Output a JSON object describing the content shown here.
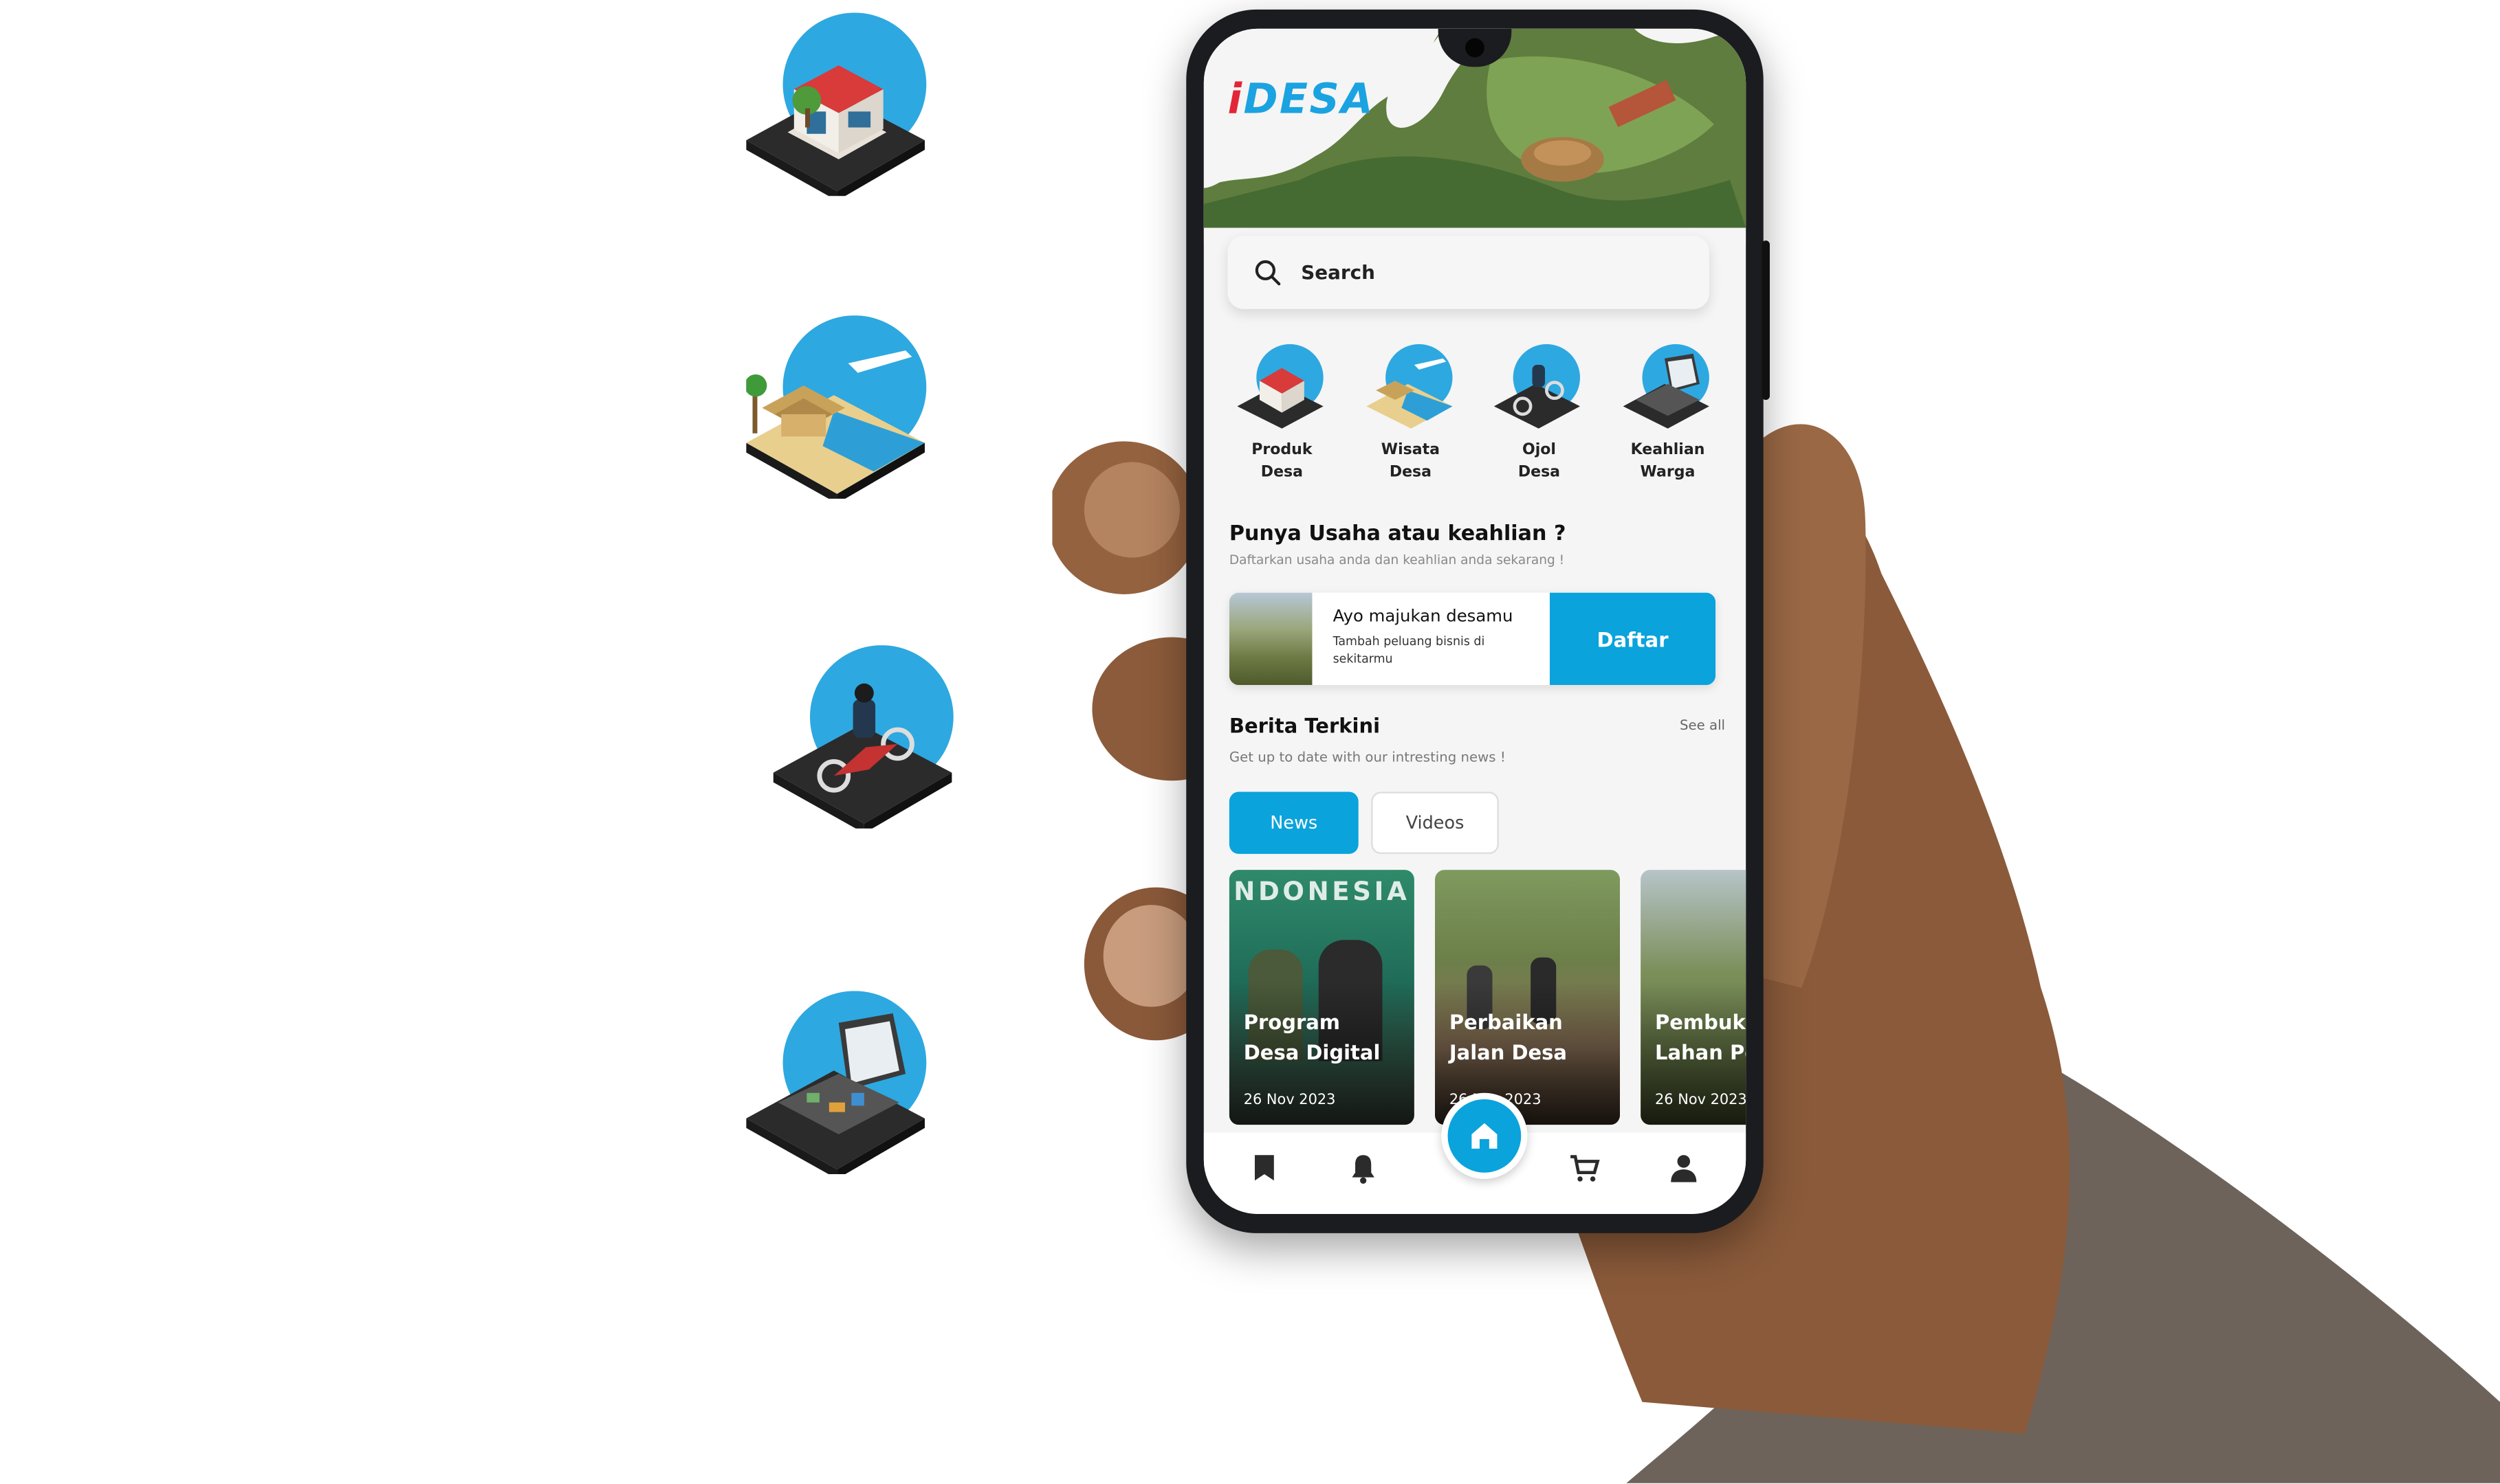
{
  "app": {
    "logo_text": "iDESA"
  },
  "search": {
    "placeholder": "Search"
  },
  "categories": [
    {
      "label_line1": "Produk",
      "label_line2": "Desa",
      "icon": "shop-icon"
    },
    {
      "label_line1": "Wisata",
      "label_line2": "Desa",
      "icon": "beach-resort-icon"
    },
    {
      "label_line1": "Ojol",
      "label_line2": "Desa",
      "icon": "motorbike-icon"
    },
    {
      "label_line1": "Keahlian",
      "label_line2": "Warga",
      "icon": "toolkit-laptop-icon"
    }
  ],
  "promo": {
    "title": "Punya Usaha atau keahlian ?",
    "subtitle": "Daftarkan usaha anda dan keahlian anda sekarang !",
    "card_title": "Ayo majukan desamu",
    "card_text": "Tambah peluang bisnis di sekitarmu",
    "button": "Daftar"
  },
  "news": {
    "title": "Berita Terkini",
    "see_all": "See all",
    "subtitle": "Get up to date with our intresting news !",
    "tabs": [
      {
        "label": "News",
        "active": true
      },
      {
        "label": "Videos",
        "active": false
      }
    ],
    "cards": [
      {
        "title_line1": "Program",
        "title_line2": "Desa Digital",
        "date": "26 Nov 2023"
      },
      {
        "title_line1": "Perbaikan",
        "title_line2": "Jalan Desa",
        "date": "26 Nov 2023"
      },
      {
        "title_line1": "Pembuk",
        "title_line2": "Lahan Pe",
        "date": "26 Nov 2023"
      }
    ]
  },
  "bottom_nav": [
    "bookmark-icon",
    "bell-icon",
    "home-icon",
    "cart-icon",
    "profile-icon"
  ],
  "colors": {
    "accent": "#0aa3dc",
    "icon_disc": "#2ea8e0",
    "logo_red": "#e32636",
    "logo_blue": "#1aa3e0"
  }
}
